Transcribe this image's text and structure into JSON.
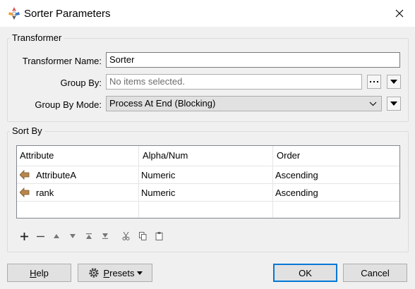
{
  "window": {
    "title": "Sorter Parameters"
  },
  "transformer_group": {
    "legend": "Transformer",
    "name_label": "Transformer Name:",
    "name_value": "Sorter",
    "groupby_label": "Group By:",
    "groupby_placeholder": "No items selected.",
    "groupbymode_label": "Group By Mode:",
    "groupbymode_value": "Process At End (Blocking)"
  },
  "sortby_group": {
    "legend": "Sort By",
    "columns": [
      "Attribute",
      "Alpha/Num",
      "Order"
    ],
    "rows": [
      {
        "attribute": "AttributeA",
        "alpha_num": "Numeric",
        "order": "Ascending"
      },
      {
        "attribute": "rank",
        "alpha_num": "Numeric",
        "order": "Ascending"
      }
    ]
  },
  "toolbar_icons": [
    "add-icon",
    "remove-icon",
    "move-up-icon",
    "move-down-icon",
    "move-top-icon",
    "move-bottom-icon",
    "cut-icon",
    "copy-icon",
    "paste-icon"
  ],
  "buttons": {
    "help_first": "H",
    "help_rest": "elp",
    "presets_first": "P",
    "presets_rest": "resets",
    "ok": "OK",
    "cancel": "Cancel"
  },
  "colors": {
    "accent": "#0078d7",
    "attribute_icon": "#b8864b"
  }
}
